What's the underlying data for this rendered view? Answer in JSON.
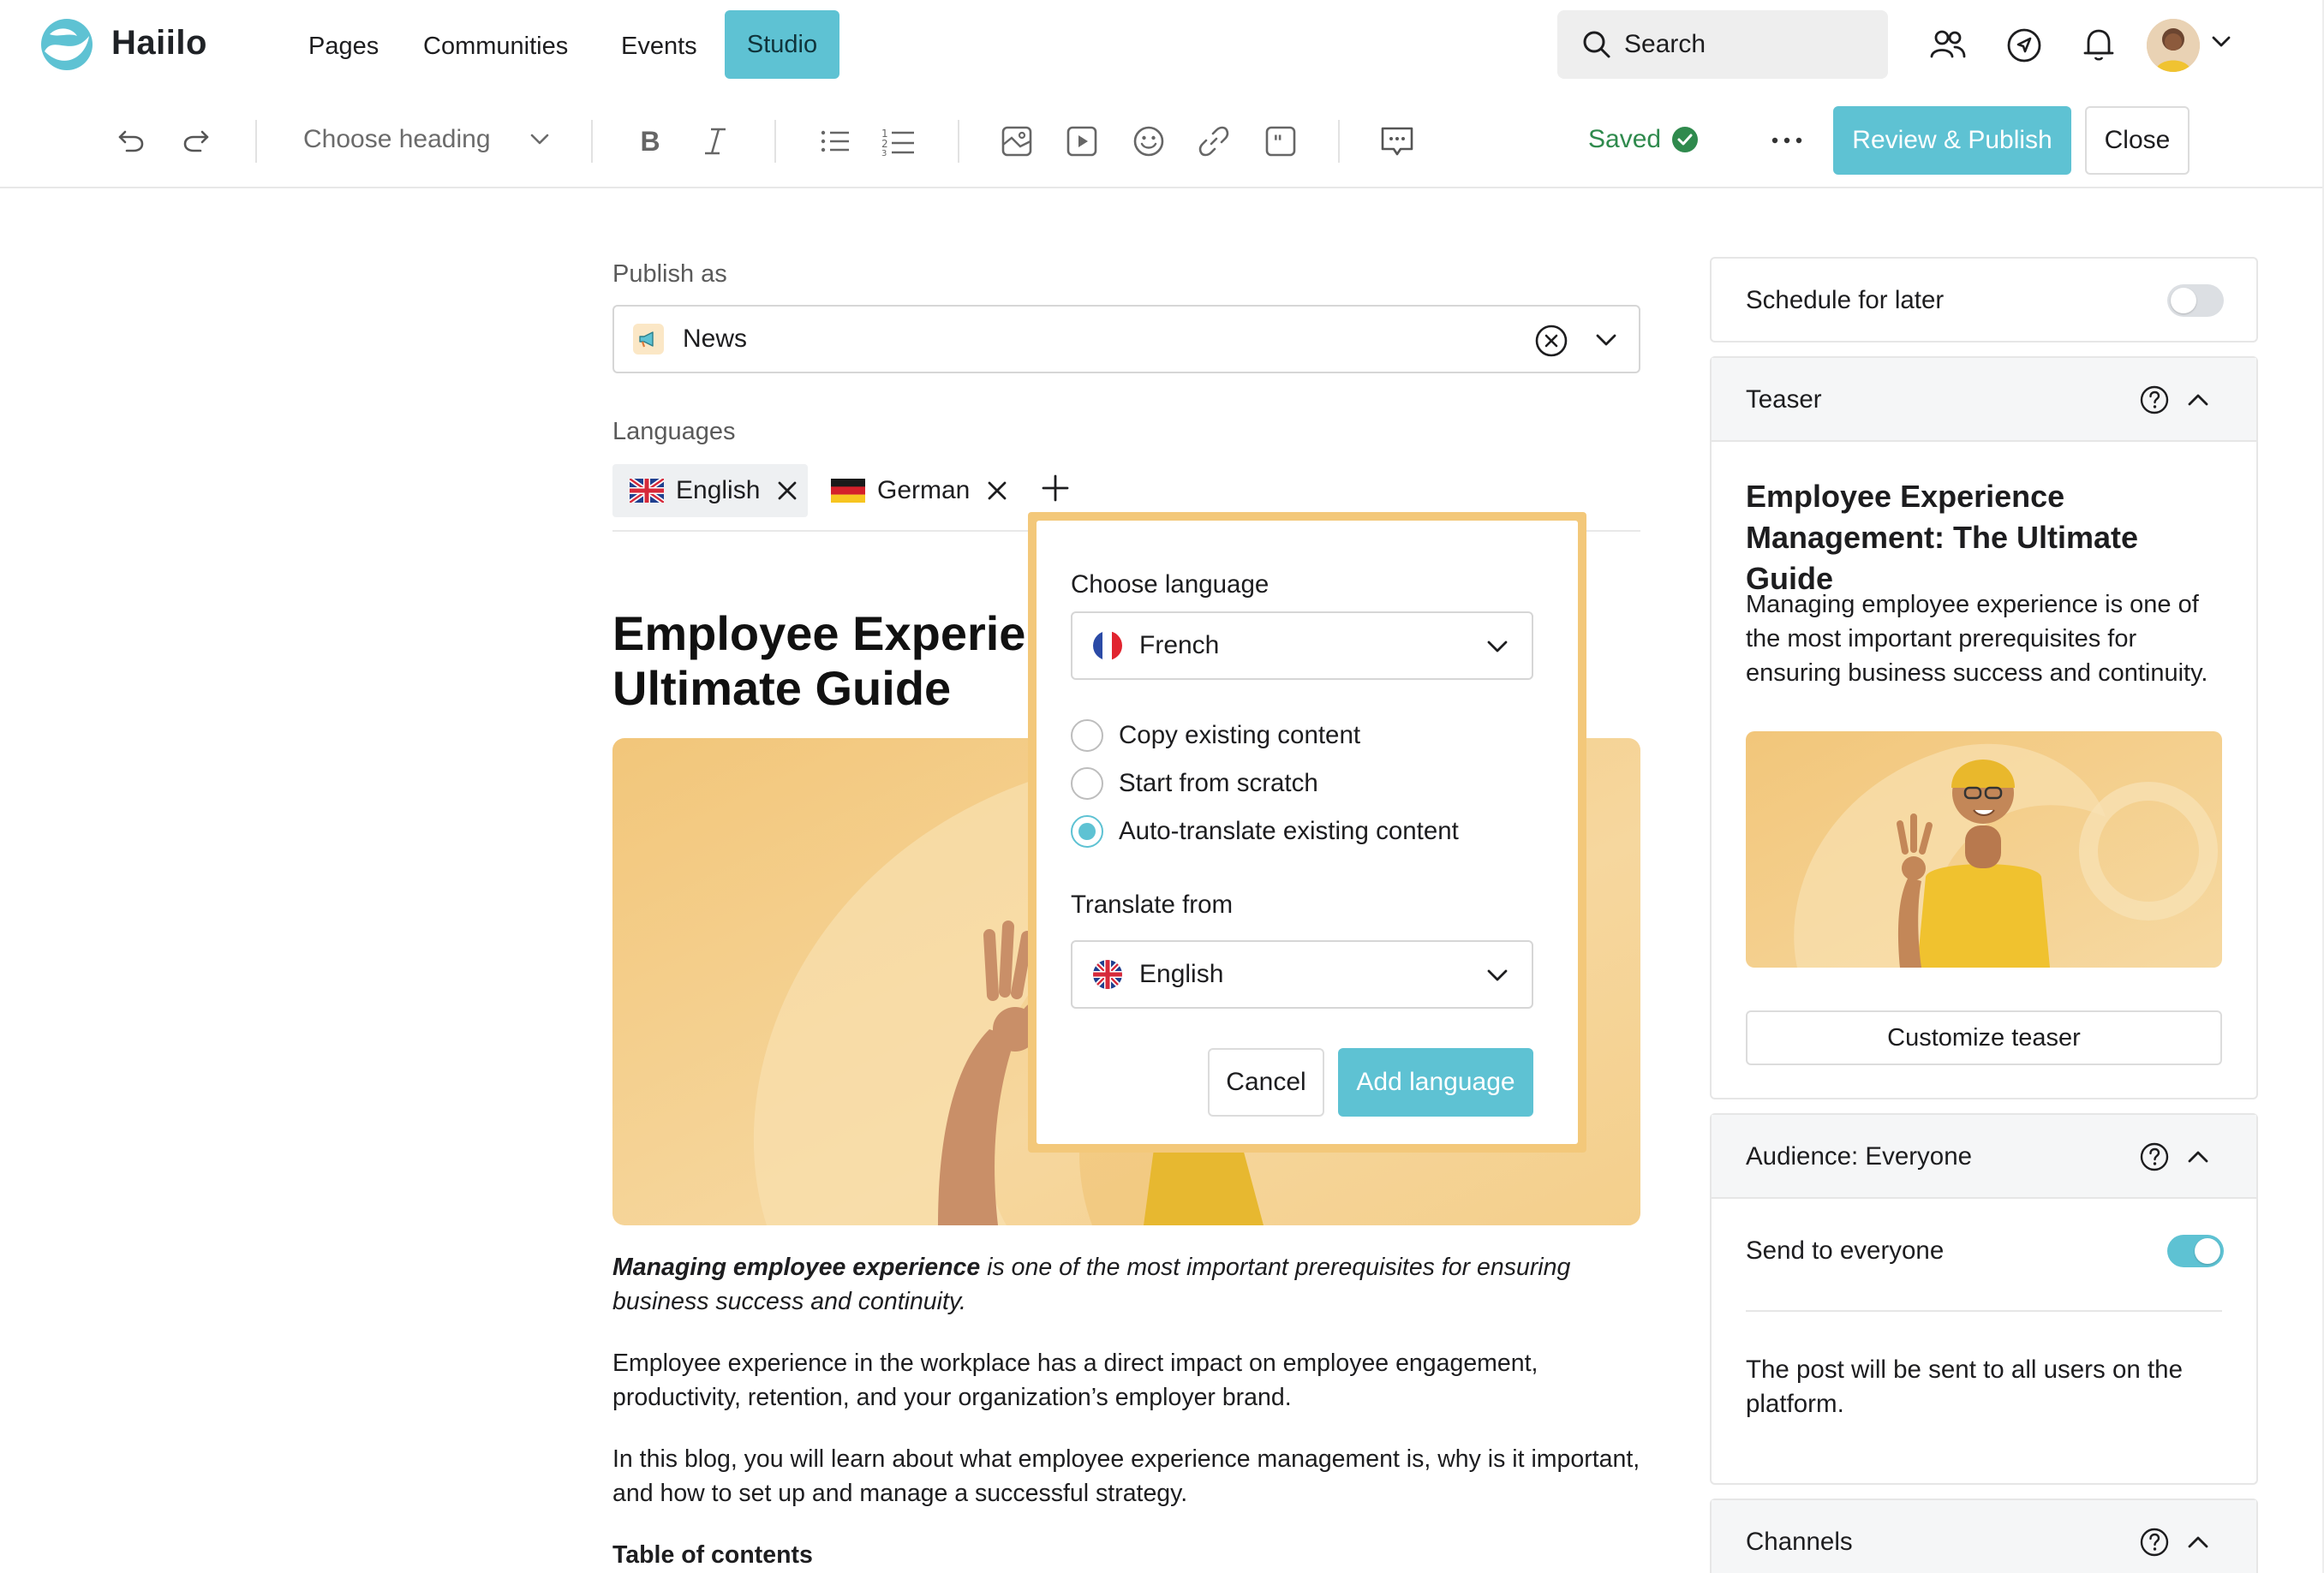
{
  "colors": {
    "accent": "#5ec2d3",
    "popover_border": "#f3c87a",
    "saved_green": "#2f8a4d",
    "text": "#1d1d1f"
  },
  "nav": {
    "brand": "Haiilo",
    "links": [
      "Pages",
      "Communities",
      "Events",
      "Studio"
    ],
    "active": "Studio",
    "search_label": "Search",
    "icons": [
      "people-icon",
      "compass-icon",
      "bell-icon",
      "avatar",
      "chevron-down-icon"
    ]
  },
  "toolbar": {
    "heading_select": "Choose heading",
    "saved_label": "Saved",
    "more_label": "•••",
    "review_publish": "Review & Publish",
    "close": "Close"
  },
  "editor": {
    "publish_as_label": "Publish as",
    "publish_as_value": "News",
    "languages_label": "Languages",
    "languages": [
      {
        "name": "English",
        "flag": "uk"
      },
      {
        "name": "German",
        "flag": "de"
      }
    ],
    "title_line1": "Employee Experienc",
    "title_line2": "Ultimate Guide",
    "intro_bold": "Managing employee experience",
    "intro_rest": " is one of the most important prerequisites for ensuring business success and continuity.",
    "para1": "Employee experience in the workplace has a direct impact on employee engagement, productivity, retention, and your organization’s employer brand.",
    "para2": "In this blog, you will learn about what employee experience management is, why is it important, and how to set up and manage a successful strategy.",
    "toc": "Table of contents"
  },
  "popover": {
    "choose_language_label": "Choose language",
    "choose_language_value": "French",
    "options": [
      {
        "label": "Copy existing content",
        "selected": false
      },
      {
        "label": "Start from scratch",
        "selected": false
      },
      {
        "label": "Auto-translate existing content",
        "selected": true
      }
    ],
    "translate_from_label": "Translate from",
    "translate_from_value": "English",
    "cancel": "Cancel",
    "add_language": "Add language"
  },
  "sidebar": {
    "schedule_label": "Schedule for later",
    "schedule_on": false,
    "teaser_header": "Teaser",
    "teaser_title": "Employee Experience Management: The Ultimate Guide",
    "teaser_text": "Managing employee experience is one of the most important prerequisites for ensuring business success and continuity.",
    "customize_teaser": "Customize teaser",
    "audience_header": "Audience: Everyone",
    "send_to_everyone": "Send to everyone",
    "send_to_everyone_on": true,
    "audience_note": "The post will be sent to all users on the platform.",
    "channels_header": "Channels"
  }
}
